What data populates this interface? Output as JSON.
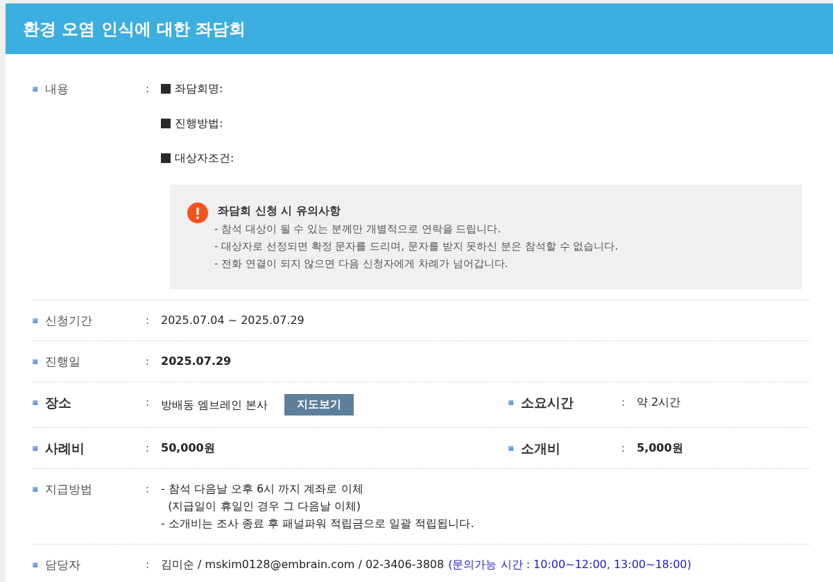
{
  "header": {
    "title": "환경 오염 인식에 대한 좌담회"
  },
  "separator": ":",
  "rows": [
    {
      "kind": "content",
      "fields": [
        {
          "label": "내용",
          "label_strong": false,
          "value_strong": false,
          "items": [
            "좌담회명:",
            "진행방법:",
            "대상자조건:"
          ]
        }
      ],
      "notice": {
        "title": "좌담회 신청 시 유의사항",
        "lines": [
          "- 참석 대상이 될 수 있는 분께만 개별적으로 연락을 드립니다.",
          "- 대상자로 선정되면 확정 문자를 드리며, 문자를 받지 못하신 분은 참석할 수 없습니다.",
          "- 전화 연결이 되지 않으면 다음 신청자에게 차례가 넘어갑니다."
        ]
      }
    },
    {
      "kind": "plain",
      "fields": [
        {
          "label": "신청기간",
          "label_strong": false,
          "value_strong": false,
          "lines": [
            "2025.07.04 ~ 2025.07.29"
          ]
        }
      ]
    },
    {
      "kind": "plain",
      "fields": [
        {
          "label": "진행일",
          "label_strong": false,
          "value_strong": true,
          "lines": [
            "2025.07.29"
          ]
        }
      ]
    },
    {
      "kind": "plain",
      "fields": [
        {
          "label": "장소",
          "label_strong": true,
          "value_strong": false,
          "lines": [
            "방배동 엠브레인 본사"
          ],
          "button": "지도보기"
        },
        {
          "label": "소요시간",
          "label_strong": true,
          "value_strong": false,
          "lines": [
            "약 2시간"
          ]
        }
      ]
    },
    {
      "kind": "plain",
      "fields": [
        {
          "label": "사례비",
          "label_strong": true,
          "value_strong": true,
          "lines": [
            "50,000원"
          ]
        },
        {
          "label": "소개비",
          "label_strong": true,
          "value_strong": true,
          "lines": [
            "5,000원"
          ]
        }
      ]
    },
    {
      "kind": "plain",
      "fields": [
        {
          "label": "지급방법",
          "label_strong": false,
          "value_strong": false,
          "lines": [
            "- 참석 다음날 오후 6시 까지 계좌로 이체",
            "  (지급일이 휴일인 경우 그 다음날 이체)",
            "- 소개비는 조사 종료 후 패널파워 적립금으로 일괄 적립됩니다."
          ]
        }
      ]
    },
    {
      "kind": "plain",
      "fields": [
        {
          "label": "담당자",
          "label_strong": false,
          "value_strong": false,
          "lines": [
            "김미순 / mskim0128@embrain.com / 02-3406-3808"
          ],
          "note": "(문의가능 시간 : 10:00~12:00, 13:00~18:00)"
        }
      ]
    }
  ]
}
